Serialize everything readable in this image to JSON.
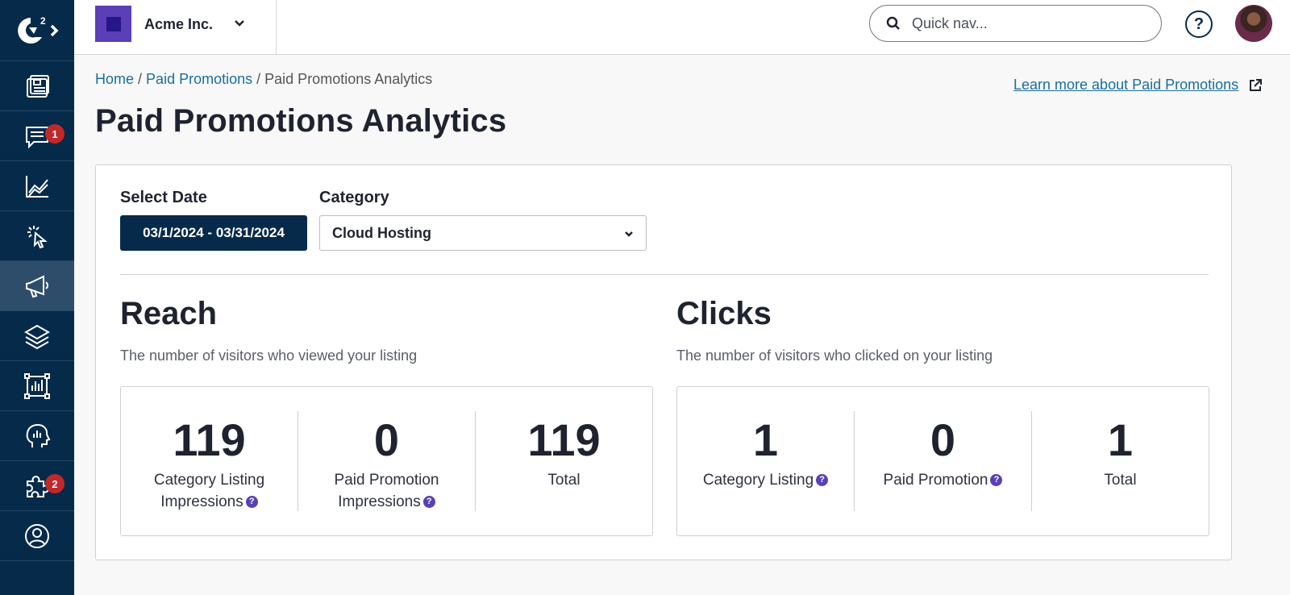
{
  "topbar": {
    "org_name": "Acme Inc.",
    "search_placeholder": "Quick nav...",
    "help_label": "?"
  },
  "sidebar": {
    "logo": "g2-logo",
    "items": [
      {
        "icon": "dashboard-icon"
      },
      {
        "icon": "chat-icon",
        "badge": "1"
      },
      {
        "icon": "analytics-icon"
      },
      {
        "icon": "click-icon"
      },
      {
        "icon": "megaphone-icon",
        "active": true
      },
      {
        "icon": "layers-icon"
      },
      {
        "icon": "report-icon"
      },
      {
        "icon": "insights-icon"
      },
      {
        "icon": "puzzle-icon",
        "badge": "2"
      },
      {
        "icon": "account-icon"
      }
    ]
  },
  "breadcrumb": {
    "home": "Home",
    "paid_promotions": "Paid Promotions",
    "current": "Paid Promotions Analytics"
  },
  "learn_more": "Learn more about Paid Promotions",
  "page_title": "Paid Promotions Analytics",
  "filters": {
    "date_label": "Select Date",
    "date_value": "03/1/2024 - 03/31/2024",
    "category_label": "Category",
    "category_value": "Cloud Hosting"
  },
  "reach": {
    "title": "Reach",
    "description": "The number of visitors who viewed your listing",
    "stats": [
      {
        "value": "119",
        "label": "Category Listing Impressions",
        "help": true
      },
      {
        "value": "0",
        "label": "Paid Promotion Impressions",
        "help": true
      },
      {
        "value": "119",
        "label": "Total",
        "help": false
      }
    ]
  },
  "clicks": {
    "title": "Clicks",
    "description": "The number of visitors who clicked on your listing",
    "stats": [
      {
        "value": "1",
        "label": "Category Listing",
        "help": true
      },
      {
        "value": "0",
        "label": "Paid Promotion",
        "help": true
      },
      {
        "value": "1",
        "label": "Total",
        "help": false
      }
    ]
  },
  "colors": {
    "sidebar_bg": "#062a4a",
    "accent_purple": "#5b3fb8",
    "link_blue": "#1a6ea0",
    "badge_red": "#c0282a"
  }
}
